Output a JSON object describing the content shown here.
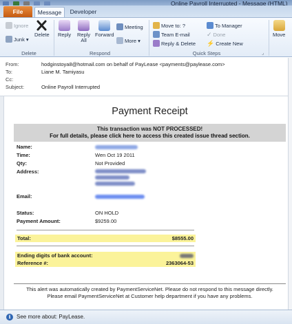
{
  "window": {
    "title": "Online Payroll Interrupted - Message (HTML)"
  },
  "tabs": {
    "file": "File",
    "message": "Message",
    "developer": "Developer"
  },
  "ribbon": {
    "delete_group": {
      "label": "Delete",
      "ignore": "Ignore",
      "junk": "Junk",
      "delete": "Delete"
    },
    "respond_group": {
      "label": "Respond",
      "reply": "Reply",
      "reply_all_1": "Reply",
      "reply_all_2": "All",
      "forward": "Forward",
      "meeting": "Meeting",
      "more": "More"
    },
    "quicksteps_group": {
      "label": "Quick Steps",
      "move_to": "Move to: ?",
      "team_email": "Team E-mail",
      "reply_delete": "Reply & Delete",
      "to_manager": "To Manager",
      "done": "Done",
      "create_new": "Create New"
    },
    "move": {
      "label": "Move"
    }
  },
  "headers": {
    "from_label": "From:",
    "from_value": "hodginstoya8@hotmail.com on behalf of PayLease <payments@paylease.com>",
    "to_label": "To:",
    "to_value": "Liane M. Tamiyasu",
    "cc_label": "Cc:",
    "subject_label": "Subject:",
    "subject_value": "Online Payroll Interrupted"
  },
  "receipt": {
    "title": "Payment Receipt",
    "alert_line1": "This transaction was NOT PROCESSED!",
    "alert_line2": "For full details, please click here to access this created issue thread section.",
    "fields": {
      "name_label": "Name:",
      "time_label": "Time:",
      "time_value": "Wen Oct 19 2011",
      "qty_label": "Qty:",
      "qty_value": "Not Provided",
      "address_label": "Address:",
      "email_label": "Email:",
      "status_label": "Status:",
      "status_value": "ON HOLD",
      "amount_label": "Payment Amount:",
      "amount_value": "$9259.00"
    },
    "total_label": "Total:",
    "total_value": "$8555.00",
    "bank_label": "Ending digits of bank account:",
    "reference_label": "Reference #:",
    "reference_value": "2363064-53",
    "footer_line1": "This alert was automatically created by PaymentServiceNet. Please do not respond to this message directly.",
    "footer_line2": "Please email PaymentServiceNet at Customer help department if you have any problems."
  },
  "infobar": {
    "text": "See more about: PayLease."
  },
  "colors": {
    "file_tab": "#c55a11",
    "highlight": "#fbf39a",
    "alert_bg": "#d4d4d4",
    "ribbon_border": "#9fb5d2"
  }
}
